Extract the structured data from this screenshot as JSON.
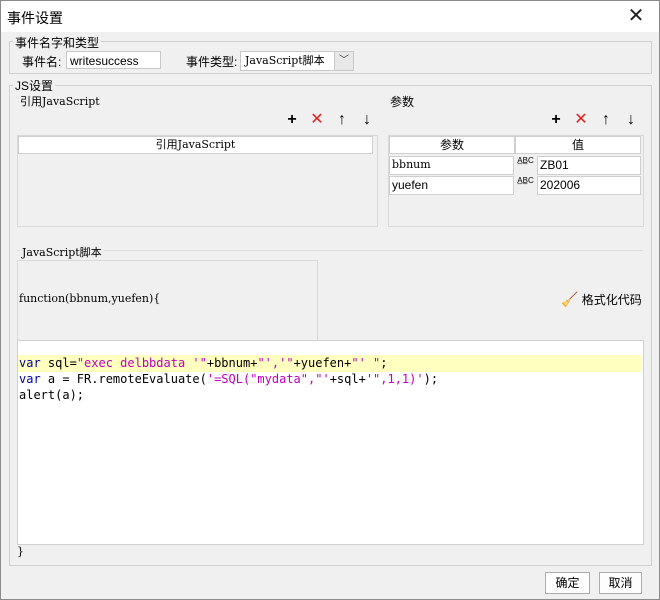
{
  "window": {
    "title": "事件设置",
    "close_glyph": "✕"
  },
  "event_group": {
    "legend": "事件名字和类型",
    "name_label": "事件名:",
    "name_value": "writesuccess",
    "type_label": "事件类型:",
    "type_value": "JavaScript脚本"
  },
  "js_group": {
    "legend": "JS设置",
    "ref_section": {
      "label": "引用JavaScript",
      "column_header": "引用JavaScript"
    },
    "params_section": {
      "label": "参数",
      "headers": [
        "参数",
        "值"
      ],
      "rows": [
        {
          "name": "bbnum",
          "type_glyph": "A̲B̲C",
          "value": "ZB01"
        },
        {
          "name": "yuefen",
          "type_glyph": "A̲B̲C",
          "value": "202006"
        }
      ]
    },
    "script_section": {
      "label": "JavaScript脚本",
      "function_header": "function(bbnum,yuefen){",
      "format_button": "格式化代码",
      "closing_brace": "}"
    }
  },
  "toolbar_icons": {
    "add": "+",
    "remove": "✕",
    "up": "↑",
    "down": "↓"
  },
  "colors": {
    "remove_red": "#e02020",
    "highlight_line": "#ffffc0",
    "keyword": "#00009c",
    "string": "#c000c0"
  },
  "footer": {
    "ok_label": "确定",
    "cancel_label": "取消"
  }
}
